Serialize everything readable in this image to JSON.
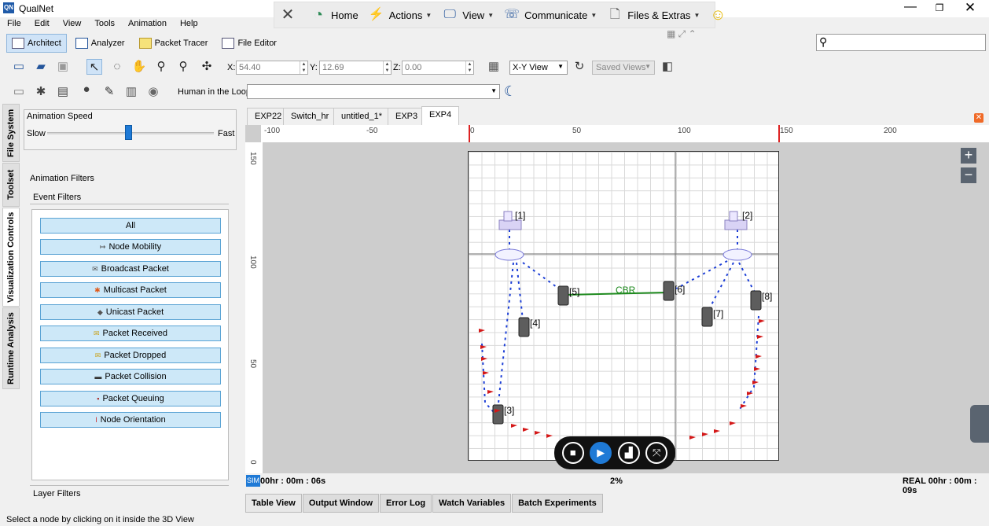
{
  "app": {
    "logo": "QN",
    "title": "QualNet"
  },
  "window_controls": {
    "minimize": "—",
    "maximize": "❐",
    "close": "✕"
  },
  "quickbar": {
    "items": [
      {
        "icon": "close-x-icon",
        "glyph": "✕",
        "label": ""
      },
      {
        "icon": "home-icon",
        "glyph": "◔",
        "label": "Home"
      },
      {
        "icon": "actions-lightning-icon",
        "glyph": "⚡",
        "label": "Actions"
      },
      {
        "icon": "view-monitor-icon",
        "glyph": "🖵",
        "label": "View"
      },
      {
        "icon": "communicate-icon",
        "glyph": "☏",
        "label": "Communicate"
      },
      {
        "icon": "files-icon",
        "glyph": "🗋",
        "label": "Files & Extras"
      },
      {
        "icon": "smiley-icon",
        "glyph": "☺",
        "label": ""
      }
    ]
  },
  "menu": [
    "File",
    "Edit",
    "View",
    "Tools",
    "Animation",
    "Help"
  ],
  "modes": [
    "Architect",
    "Analyzer",
    "Packet Tracer",
    "File Editor"
  ],
  "coords": {
    "x_label": "X:",
    "x": "54.40",
    "y_label": "Y:",
    "y": "12.69",
    "z_label": "Z:",
    "z": "0.00"
  },
  "view_select": "X-Y View",
  "saved_views": "Saved Views",
  "hitl_label": "Human in the Loop:",
  "side_tabs": [
    "File System",
    "Toolset",
    "Visualization Controls",
    "Runtime Analysis"
  ],
  "anim_speed": {
    "title": "Animation Speed",
    "slow": "Slow",
    "fast": "Fast",
    "level": 0.49
  },
  "filters": {
    "title": "Animation Filters",
    "event_title": "Event Filters",
    "items": [
      {
        "label": "All",
        "icon": ""
      },
      {
        "label": "Node Mobility",
        "icon": "↦"
      },
      {
        "label": "Broadcast Packet",
        "icon": "✉"
      },
      {
        "label": "Multicast Packet",
        "icon": "✱"
      },
      {
        "label": "Unicast Packet",
        "icon": "◆"
      },
      {
        "label": "Packet Received",
        "icon": "✉"
      },
      {
        "label": "Packet Dropped",
        "icon": "✉"
      },
      {
        "label": "Packet Collision",
        "icon": "▬"
      },
      {
        "label": "Packet Queuing",
        "icon": "▪"
      },
      {
        "label": "Node Orientation",
        "icon": "ǀ"
      }
    ],
    "layer_title": "Layer Filters"
  },
  "view_tabs": [
    "EXP22",
    "Switch_hr",
    "untitled_1*",
    "EXP3",
    "EXP4"
  ],
  "active_tab": "EXP4",
  "ruler_top": [
    "-100",
    "-50",
    "0",
    "50",
    "100",
    "150",
    "200"
  ],
  "ruler_left": [
    "150",
    "100",
    "50",
    "0"
  ],
  "nodes": [
    {
      "id": "[1]",
      "type": "router-icon"
    },
    {
      "id": "[2]",
      "type": "router-icon"
    },
    {
      "id": "[3]",
      "type": "handheld-node-icon"
    },
    {
      "id": "[4]",
      "type": "handheld-node-icon"
    },
    {
      "id": "[5]",
      "type": "handheld-node-icon"
    },
    {
      "id": "[6]",
      "type": "handheld-node-icon"
    },
    {
      "id": "[7]",
      "type": "handheld-node-icon"
    },
    {
      "id": "[8]",
      "type": "handheld-node-icon"
    }
  ],
  "link_label": "CBR",
  "zoom": {
    "in": "+",
    "out": "−"
  },
  "status": {
    "sim_badge": "SIM",
    "sim_time": "00hr : 00m : 06s",
    "progress": "2%",
    "real_time": "REAL 00hr : 00m : 09s"
  },
  "bottom_tabs": [
    "Table View",
    "Output Window",
    "Error Log",
    "Watch Variables",
    "Batch Experiments"
  ],
  "status_message": "Select a node by clicking on it inside the 3D View"
}
